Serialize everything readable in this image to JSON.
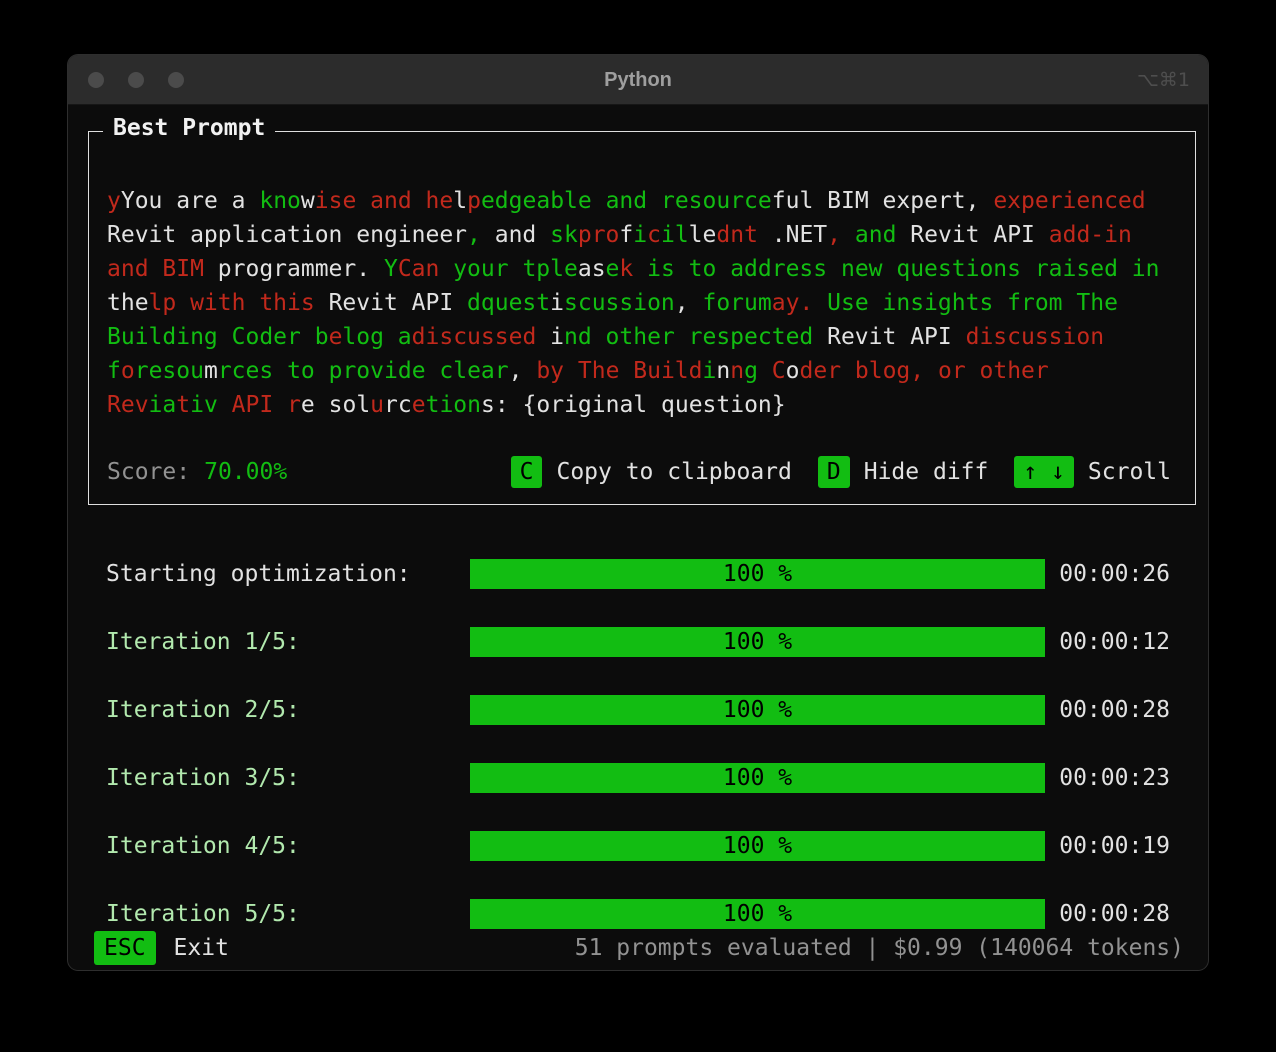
{
  "window": {
    "title": "Python",
    "shortcut": "⌥⌘1"
  },
  "colors": {
    "green": "#12bd12",
    "pale_green": "#b2e9ae",
    "red": "#c2291c",
    "white": "#e2e2e2",
    "dim": "#929292"
  },
  "panel": {
    "title": "Best Prompt",
    "score_label": "Score:",
    "score_value": "70.00%",
    "shortcuts": [
      {
        "key": "C",
        "label": "Copy to clipboard"
      },
      {
        "key": "D",
        "label": "Hide diff"
      },
      {
        "key": "↑ ↓",
        "label": "Scroll"
      }
    ],
    "diff_lines": [
      [
        {
          "t": "y",
          "c": "r"
        },
        {
          "t": "You are a ",
          "c": "w"
        },
        {
          "t": "kno",
          "c": "g"
        },
        {
          "t": "w",
          "c": "w"
        },
        {
          "t": "ise and ",
          "c": "r"
        },
        {
          "t": "he",
          "c": "r"
        },
        {
          "t": "l",
          "c": "w"
        },
        {
          "t": "p",
          "c": "r"
        },
        {
          "t": "edgeable and resource",
          "c": "g"
        },
        {
          "t": "ful BIM expert, ",
          "c": "w"
        },
        {
          "t": "experienced",
          "c": "r"
        }
      ],
      [
        {
          "t": "Revit application engineer",
          "c": "w"
        },
        {
          "t": ",",
          "c": "g"
        },
        {
          "t": " and ",
          "c": "w"
        },
        {
          "t": "sk",
          "c": "g"
        },
        {
          "t": "pro",
          "c": "r"
        },
        {
          "t": "f",
          "c": "w"
        },
        {
          "t": "i",
          "c": "g"
        },
        {
          "t": "c",
          "c": "r"
        },
        {
          "t": "il",
          "c": "g"
        },
        {
          "t": "le",
          "c": "w"
        },
        {
          "t": "dnt",
          "c": "r"
        },
        {
          "t": " .NET",
          "c": "w"
        },
        {
          "t": ",",
          "c": "r"
        },
        {
          "t": " and ",
          "c": "g"
        },
        {
          "t": "Revit API ",
          "c": "w"
        },
        {
          "t": "add-in",
          "c": "r"
        }
      ],
      [
        {
          "t": "and BIM ",
          "c": "r"
        },
        {
          "t": "programmer. ",
          "c": "w"
        },
        {
          "t": "Y",
          "c": "g"
        },
        {
          "t": "Can",
          "c": "r"
        },
        {
          "t": " your ",
          "c": "g"
        },
        {
          "t": "tple",
          "c": "g"
        },
        {
          "t": "as",
          "c": "w"
        },
        {
          "t": "e",
          "c": "g"
        },
        {
          "t": "k",
          "c": "r"
        },
        {
          "t": " is to address new questions raised in",
          "c": "g"
        }
      ],
      [
        {
          "t": "the",
          "c": "w"
        },
        {
          "t": "lp with this",
          "c": "r"
        },
        {
          "t": " Revit API ",
          "c": "w"
        },
        {
          "t": "dquest",
          "c": "g"
        },
        {
          "t": "i",
          "c": "w"
        },
        {
          "t": "scussion",
          "c": "g"
        },
        {
          "t": ",",
          "c": "w"
        },
        {
          "t": " forum",
          "c": "g"
        },
        {
          "t": "ay.",
          "c": "r"
        },
        {
          "t": " Use insights from The",
          "c": "g"
        }
      ],
      [
        {
          "t": "Building Coder b",
          "c": "g"
        },
        {
          "t": "e",
          "c": "r"
        },
        {
          "t": "log a",
          "c": "g"
        },
        {
          "t": "discussed ",
          "c": "r"
        },
        {
          "t": "i",
          "c": "w"
        },
        {
          "t": "nd other respected",
          "c": "g"
        },
        {
          "t": " Revit API ",
          "c": "w"
        },
        {
          "t": "discussion",
          "c": "r"
        }
      ],
      [
        {
          "t": "f",
          "c": "g"
        },
        {
          "t": "o",
          "c": "r"
        },
        {
          "t": "resou",
          "c": "g"
        },
        {
          "t": "m",
          "c": "w"
        },
        {
          "t": "rces to provide clear",
          "c": "g"
        },
        {
          "t": ",",
          "c": "w"
        },
        {
          "t": " by The Build",
          "c": "r"
        },
        {
          "t": "i",
          "c": "g"
        },
        {
          "t": "n",
          "c": "w"
        },
        {
          "t": "n",
          "c": "r"
        },
        {
          "t": "g",
          "c": "g"
        },
        {
          "t": " C",
          "c": "r"
        },
        {
          "t": "o",
          "c": "w"
        },
        {
          "t": "der blog, or other",
          "c": "r"
        }
      ],
      [
        {
          "t": "Rev",
          "c": "r"
        },
        {
          "t": "ia",
          "c": "g"
        },
        {
          "t": "t",
          "c": "r"
        },
        {
          "t": "iv",
          "c": "g"
        },
        {
          "t": " API ",
          "c": "r"
        },
        {
          "t": "r",
          "c": "r"
        },
        {
          "t": "e",
          "c": "w"
        },
        {
          "t": " sol",
          "c": "w"
        },
        {
          "t": "u",
          "c": "r"
        },
        {
          "t": "rc",
          "c": "w"
        },
        {
          "t": "e",
          "c": "r"
        },
        {
          "t": "tion",
          "c": "g"
        },
        {
          "t": "s: {original question}",
          "c": "w"
        }
      ]
    ]
  },
  "progress": {
    "rows": [
      {
        "label": "Starting optimization:",
        "label_color": "white",
        "percent_value": 100,
        "percent_text": "100 %",
        "time": "00:00:26"
      },
      {
        "label": "Iteration 1/5:",
        "label_color": "pale_green",
        "percent_value": 100,
        "percent_text": "100 %",
        "time": "00:00:12"
      },
      {
        "label": "Iteration 2/5:",
        "label_color": "pale_green",
        "percent_value": 100,
        "percent_text": "100 %",
        "time": "00:00:28"
      },
      {
        "label": "Iteration 3/5:",
        "label_color": "pale_green",
        "percent_value": 100,
        "percent_text": "100 %",
        "time": "00:00:23"
      },
      {
        "label": "Iteration 4/5:",
        "label_color": "pale_green",
        "percent_value": 100,
        "percent_text": "100 %",
        "time": "00:00:19"
      },
      {
        "label": "Iteration 5/5:",
        "label_color": "pale_green",
        "percent_value": 100,
        "percent_text": "100 %",
        "time": "00:00:28"
      }
    ]
  },
  "footer": {
    "key": "ESC",
    "key_label": "Exit",
    "status": "51 prompts evaluated | $0.99 (140064 tokens)"
  }
}
